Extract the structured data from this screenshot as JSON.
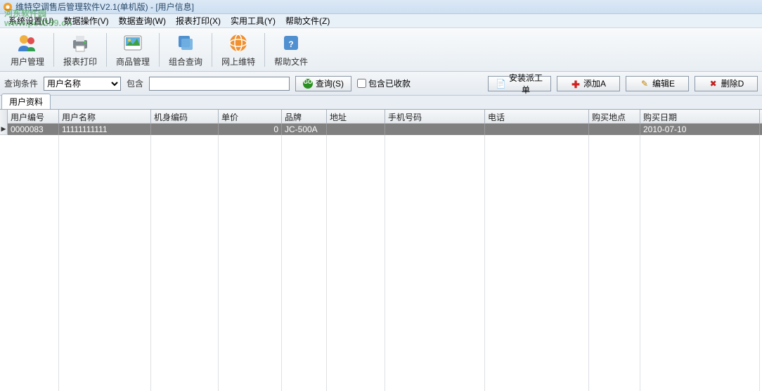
{
  "title": "维特空调售后管理软件V2.1(单机版) - [用户信息]",
  "menus": [
    "系统设置(U)",
    "数据操作(V)",
    "数据查询(W)",
    "报表打印(X)",
    "实用工具(Y)",
    "帮助文件(Z)"
  ],
  "toolbar": [
    {
      "label": "用户管理",
      "icon": "users"
    },
    {
      "label": "报表打印",
      "icon": "printer"
    },
    {
      "label": "商品管理",
      "icon": "picture"
    },
    {
      "label": "组合查询",
      "icon": "layers"
    },
    {
      "label": "网上维特",
      "icon": "globe"
    },
    {
      "label": "帮助文件",
      "icon": "help"
    }
  ],
  "search": {
    "condition_label": "查询条件",
    "field_select": "用户名称",
    "contains_label": "包含",
    "input_value": "",
    "query_btn": "查询(S)",
    "include_paid_label": "包含已收款",
    "include_paid_checked": false
  },
  "action_buttons": {
    "install": "安装派工单",
    "add": "添加A",
    "edit": "编辑E",
    "delete": "删除D"
  },
  "tab": "用户资料",
  "columns": [
    "用户编号",
    "用户名称",
    "机身编码",
    "单价",
    "品牌",
    "地址",
    "手机号码",
    "电话",
    "购买地点",
    "购买日期"
  ],
  "rows": [
    {
      "用户编号": "0000083",
      "用户名称": "11111111111",
      "机身编码": "",
      "单价": "0",
      "品牌": "JC-500A",
      "地址": "",
      "手机号码": "",
      "电话": "",
      "购买地点": "",
      "购买日期": "2010-07-10"
    }
  ],
  "watermark": {
    "main": "河东软件园",
    "sub": "www.pc0359.cn"
  }
}
